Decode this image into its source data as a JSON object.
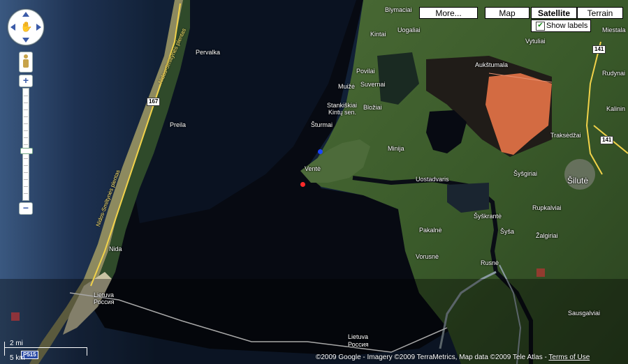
{
  "map_type_controls": {
    "more": "More...",
    "map": "Map",
    "satellite": "Satellite",
    "terrain": "Terrain",
    "active": "Satellite"
  },
  "show_labels": {
    "label": "Show labels",
    "checked": true,
    "check_glyph": "✔"
  },
  "zoom": {
    "plus": "+",
    "minus": "−",
    "level_fraction": 0.55
  },
  "places": {
    "blymaciai": "Blymaciai",
    "kintai": "Kintai",
    "uogaliai": "Uogaliai",
    "pervalka": "Pervalka",
    "povilai": "Povilai",
    "muize": "Muižė",
    "suvernai": "Suvernai",
    "stankiskiai": "Stankiškiai",
    "kintu_sen": "Kintų sen.",
    "blozai": "Bložiai",
    "sturmai": "Šturmai",
    "preila": "Preila",
    "minija": "Minija",
    "vente": "Ventė",
    "uostadvaris": "Uostadvaris",
    "aukstumala": "Aukštumala",
    "traksedzai": "Traksėdžai",
    "sysgiriai": "Šyšgiriai",
    "silute": "Šilutė",
    "kalininkai": "Kalinin",
    "rudynai": "Rudynai",
    "vytuliai": "Vytuliai",
    "miestala": "Miestala",
    "rupkalviai": "Rupkalviai",
    "sysa": "Šyša",
    "syskrante": "Šyškrantė",
    "zalgiriai": "Žalgiriai",
    "pakalne": "Pakalnė",
    "vorusne": "Vorusnė",
    "rusne": "Rusnė",
    "sausga": "Sausgalviai",
    "nida": "Nida",
    "lietuva_1": "Lietuva",
    "rossiya_1": "Россия",
    "lietuva_2": "Lietuva",
    "rossiya_2": "Россия",
    "road_name_1": "Nidos-Smiltynės plentas",
    "road_name_2": "Nidos-Smiltynės plentas"
  },
  "road_shields": {
    "r167": "167",
    "r141_top": "141",
    "r141_right": "141",
    "r515": "P515"
  },
  "scale": {
    "miles": "2 mi",
    "km": "5 km"
  },
  "copyright": "©2009 Google - Imagery ©2009 TerraMetrics, Map data ©2009 Tele Atlas - ",
  "terms_link": "Terms of Use",
  "colors": {
    "land": "#3f5a2c",
    "sea": "#0d1626",
    "lagoon": "#06080f",
    "peat": "#d86a40",
    "spit_sand": "#c6bb86"
  }
}
